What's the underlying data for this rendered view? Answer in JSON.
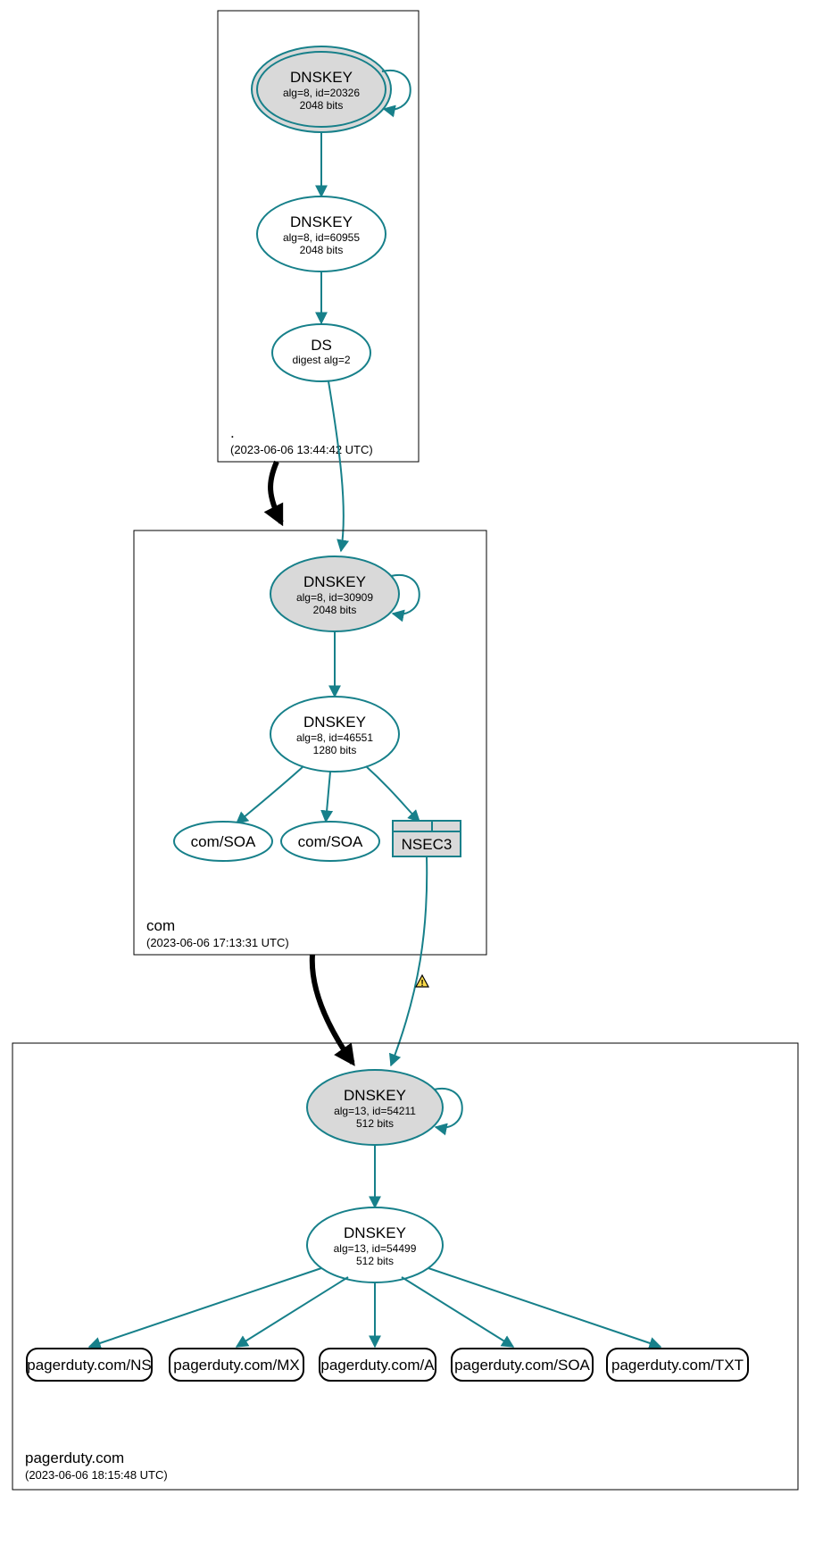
{
  "zones": {
    "root": {
      "name": ".",
      "timestamp": "(2023-06-06 13:44:42 UTC)"
    },
    "com": {
      "name": "com",
      "timestamp": "(2023-06-06 17:13:31 UTC)"
    },
    "pagerduty": {
      "name": "pagerduty.com",
      "timestamp": "(2023-06-06 18:15:48 UTC)"
    }
  },
  "nodes": {
    "root_ksk": {
      "title": "DNSKEY",
      "alg": "alg=8, id=20326",
      "bits": "2048 bits"
    },
    "root_zsk": {
      "title": "DNSKEY",
      "alg": "alg=8, id=60955",
      "bits": "2048 bits"
    },
    "root_ds": {
      "title": "DS",
      "alg": "digest alg=2"
    },
    "com_ksk": {
      "title": "DNSKEY",
      "alg": "alg=8, id=30909",
      "bits": "2048 bits"
    },
    "com_zsk": {
      "title": "DNSKEY",
      "alg": "alg=8, id=46551",
      "bits": "1280 bits"
    },
    "com_soa1": {
      "label": "com/SOA"
    },
    "com_soa2": {
      "label": "com/SOA"
    },
    "com_nsec3": {
      "label": "NSEC3"
    },
    "pd_ksk": {
      "title": "DNSKEY",
      "alg": "alg=13, id=54211",
      "bits": "512 bits"
    },
    "pd_zsk": {
      "title": "DNSKEY",
      "alg": "alg=13, id=54499",
      "bits": "512 bits"
    },
    "pd_ns": {
      "label": "pagerduty.com/NS"
    },
    "pd_mx": {
      "label": "pagerduty.com/MX"
    },
    "pd_a": {
      "label": "pagerduty.com/A"
    },
    "pd_soa": {
      "label": "pagerduty.com/SOA"
    },
    "pd_txt": {
      "label": "pagerduty.com/TXT"
    }
  }
}
